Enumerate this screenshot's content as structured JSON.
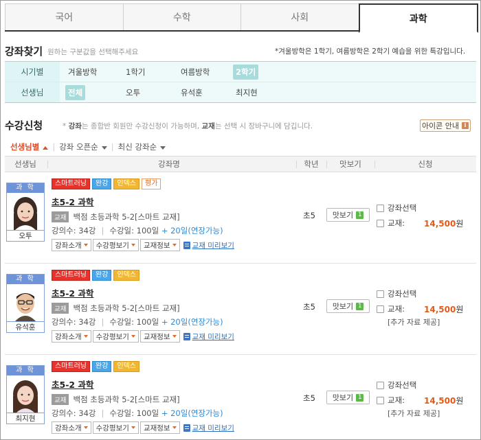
{
  "tabs": [
    {
      "label": "국어",
      "active": false
    },
    {
      "label": "수학",
      "active": false
    },
    {
      "label": "사회",
      "active": false
    },
    {
      "label": "과학",
      "active": true
    }
  ],
  "find": {
    "title": "강좌찾기",
    "desc": "원하는 구분값을 선택해주세요",
    "note": "*겨울방학은 1학기, 여름방학은 2학기 예습을 위한 특강입니다."
  },
  "filter": {
    "period_label": "시기별",
    "periods": [
      "겨울방학",
      "1학기",
      "여름방학",
      "2학기"
    ],
    "period_selected": "2학기",
    "teacher_label": "선생님",
    "teachers": [
      "전체",
      "오투",
      "유석훈",
      "최지현"
    ],
    "teacher_selected": "전체"
  },
  "enroll": {
    "title": "수강신청",
    "note_parts": [
      "* ",
      "강좌",
      "는 종합반 회원만 수강신청이 가능하며, ",
      "교재",
      "는 선택 시 장바구니에 담깁니다."
    ],
    "icon_button": "아이콘 안내",
    "icon_button_badge": "i"
  },
  "sort": {
    "by_teacher": "선생님별",
    "by_open": "강좌 오픈순",
    "by_latest": "최신 강좌순"
  },
  "columns": {
    "teacher": "선생님",
    "course": "강좌명",
    "grade": "학년",
    "preview": "맛보기",
    "apply": "신청"
  },
  "common": {
    "textbook_tag": "교재",
    "btn_intro": "강좌소개",
    "btn_review": "수강평보기",
    "btn_book": "교재정보",
    "preview_link": "교재 미리보기",
    "mat_label": "맛보기",
    "mat_num": "1",
    "check_course": "강좌선택",
    "check_book": "교재:",
    "won": "원",
    "sep": "|"
  },
  "courses": [
    {
      "subject": "과 학",
      "teacher": "오투",
      "badges": [
        "스마트러닝",
        "완강",
        "인덱스",
        "평가"
      ],
      "title": "초5-2 과학",
      "book": "백점 초등과학 5-2[스마트 교재]",
      "lectures": "강의수: 34강",
      "period": "수강일: 100일",
      "extend": "+ 20일(연장가능)",
      "grade": "초5",
      "price": "14,500",
      "extra": ""
    },
    {
      "subject": "과 학",
      "teacher": "유석훈",
      "badges": [
        "스마트러닝",
        "완강",
        "인덱스"
      ],
      "title": "초5-2 과학",
      "book": "백점 초등과학 5-2[스마트 교재]",
      "lectures": "강의수: 34강",
      "period": "수강일: 100일",
      "extend": "+ 20일(연장가능)",
      "grade": "초5",
      "price": "14,500",
      "extra": "[추가 자료 제공]"
    },
    {
      "subject": "과 학",
      "teacher": "최지현",
      "badges": [
        "스마트러닝",
        "완강",
        "인덱스"
      ],
      "title": "초5-2 과학",
      "book": "백점 초등과학 5-2[스마트 교재]",
      "lectures": "강의수: 34강",
      "period": "수강일: 100일",
      "extend": "+ 20일(연장가능)",
      "grade": "초5",
      "price": "14,500",
      "extra": "[추가 자료 제공]"
    }
  ]
}
